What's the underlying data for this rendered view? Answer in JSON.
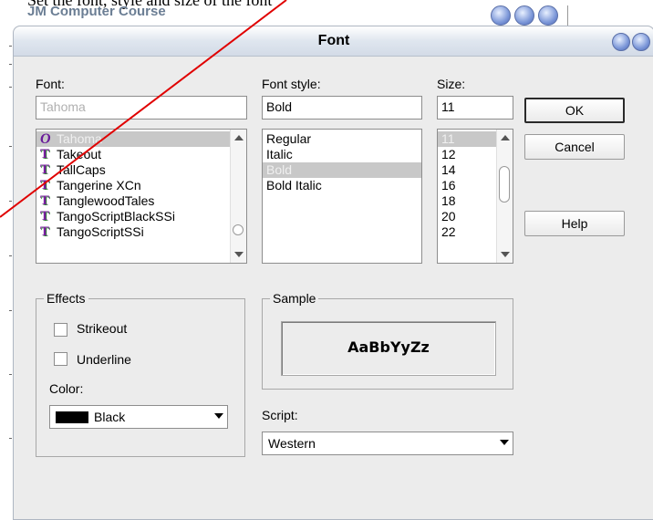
{
  "background": {
    "title": "JM Computer Course",
    "text_partial": "Set the font, style and size of the font"
  },
  "dialog": {
    "title": "Font",
    "font": {
      "label": "Font:",
      "value": "Tahoma",
      "items": [
        {
          "name": "Tahoma",
          "type_icon": "opentype-icon",
          "selected": true
        },
        {
          "name": "Takeout",
          "type_icon": "truetype-icon"
        },
        {
          "name": "TallCaps",
          "type_icon": "truetype-icon"
        },
        {
          "name": "Tangerine XCn",
          "type_icon": "truetype-icon"
        },
        {
          "name": "TanglewoodTales",
          "type_icon": "truetype-icon"
        },
        {
          "name": "TangoScriptBlackSSi",
          "type_icon": "truetype-icon"
        },
        {
          "name": "TangoScriptSSi",
          "type_icon": "truetype-icon"
        }
      ]
    },
    "style": {
      "label": "Font style:",
      "value": "Bold",
      "items": [
        "Regular",
        "Italic",
        "Bold",
        "Bold Italic"
      ],
      "selected_index": 2
    },
    "size": {
      "label": "Size:",
      "value": "11",
      "items": [
        "11",
        "12",
        "14",
        "16",
        "18",
        "20",
        "22"
      ],
      "selected_index": 0
    },
    "buttons": {
      "ok": "OK",
      "cancel": "Cancel",
      "help": "Help"
    },
    "effects": {
      "label": "Effects",
      "strikeout": {
        "label": "Strikeout",
        "checked": false
      },
      "underline": {
        "label": "Underline",
        "checked": false
      },
      "color_label": "Color:",
      "color_value": "Black",
      "color_hex": "#000000"
    },
    "sample": {
      "label": "Sample",
      "text": "AaBbYyZz"
    },
    "script": {
      "label": "Script:",
      "value": "Western"
    }
  },
  "colors": {
    "annotation_line": "#e00000",
    "selection": "#c8c8c8",
    "dialog_bg": "#ececec"
  }
}
